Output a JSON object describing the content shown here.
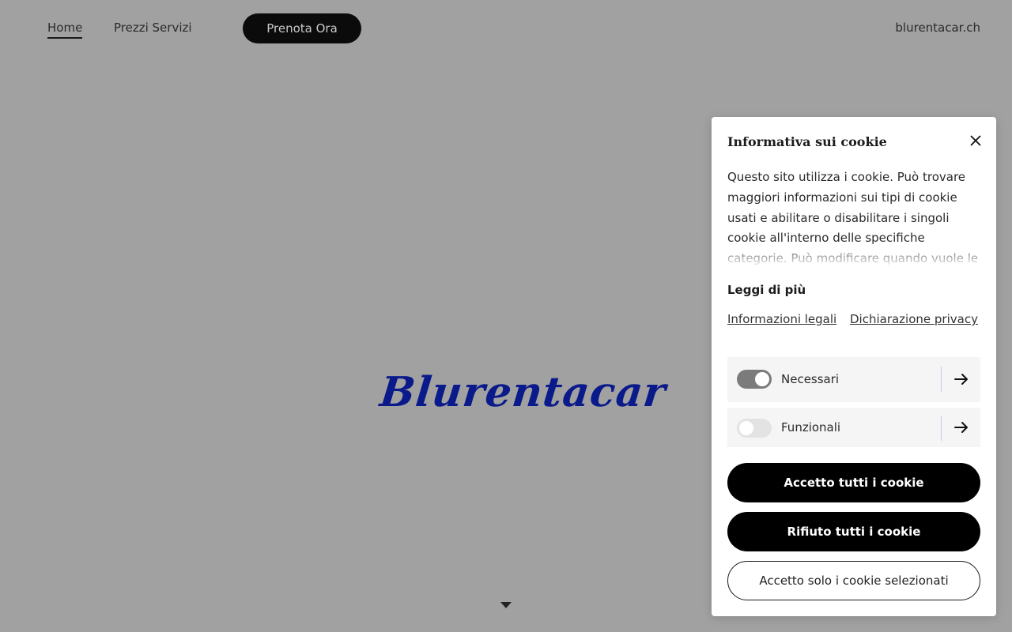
{
  "nav": {
    "home": "Home",
    "prezzi": "Prezzi Servizi",
    "cta": "Prenota Ora",
    "domain": "blurentacar.ch"
  },
  "hero": {
    "logo_text": "Blurentacar",
    "logo_color": "#0a1a8a"
  },
  "cookie": {
    "title": "Informativa sui cookie",
    "text": "Questo sito utilizza i cookie. Può trovare maggiori informazioni sui tipi di cookie usati e abilitare o disabilitare i singoli cookie all'interno delle specifiche categorie. Può modificare quando vuole le",
    "read_more": "Leggi di più",
    "link_legal": "Informazioni legali",
    "link_privacy": "Dichiarazione privacy",
    "categories": [
      {
        "label": "Necessari",
        "enabled": true
      },
      {
        "label": "Funzionali",
        "enabled": false
      }
    ],
    "accept_all": "Accetto tutti i cookie",
    "reject_all": "Rifiuto tutti i cookie",
    "accept_selected": "Accetto solo i cookie selezionati"
  },
  "icons": {
    "close": "close-icon",
    "category_arrow": "arrow-right-icon",
    "scroll": "caret-down-icon"
  }
}
